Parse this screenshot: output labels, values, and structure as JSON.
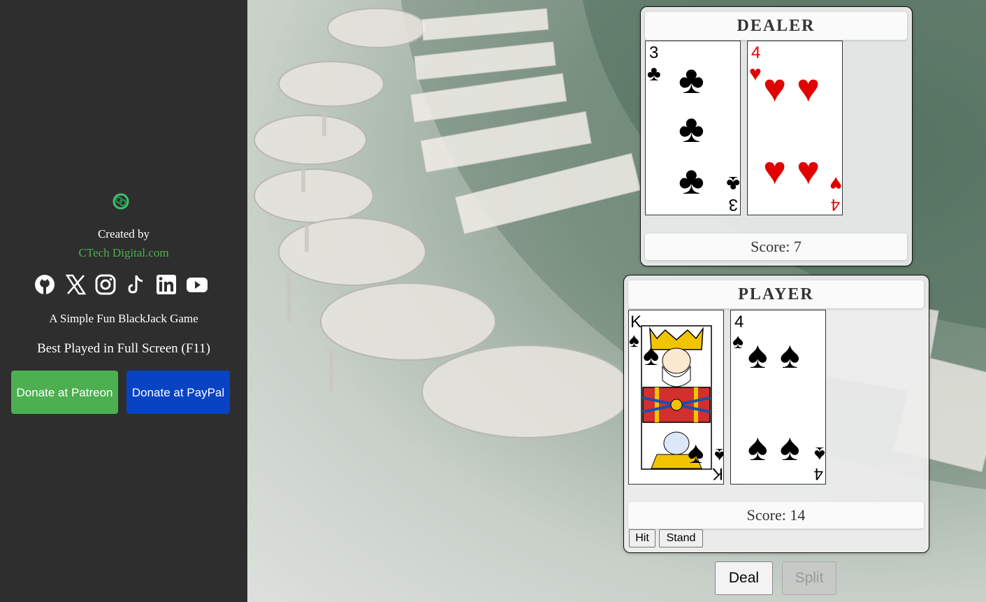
{
  "sidebar": {
    "logo_icon": "ctech-logo-icon",
    "created_by": "Created by",
    "site_link": "CTech Digital.com",
    "social_icons": [
      "github-icon",
      "x-icon",
      "instagram-icon",
      "tiktok-icon",
      "linkedin-icon",
      "youtube-icon"
    ],
    "tagline": "A Simple Fun BlackJack Game",
    "fullscreen_note": "Best Played in Full Screen (F11)",
    "donate_patreon": "Donate at Patreon",
    "donate_paypal": "Donate at PayPal"
  },
  "dealer": {
    "title": "DEALER",
    "cards": [
      {
        "rank": "3",
        "suit": "clubs",
        "symbol": "♣",
        "color": "#000000"
      },
      {
        "rank": "4",
        "suit": "hearts",
        "symbol": "♥",
        "color": "#e00000"
      }
    ],
    "score": "Score: 7"
  },
  "player": {
    "title": "PLAYER",
    "cards": [
      {
        "rank": "K",
        "suit": "spades",
        "symbol": "♠",
        "color": "#000000"
      },
      {
        "rank": "4",
        "suit": "spades",
        "symbol": "♠",
        "color": "#000000"
      }
    ],
    "score": "Score: 14",
    "hit_label": "Hit",
    "stand_label": "Stand"
  },
  "controls": {
    "deal_label": "Deal",
    "split_label": "Split"
  },
  "colors": {
    "sidebar_bg": "#2e2e2e",
    "link": "#4CAF50",
    "patreon": "#4CAF50",
    "paypal": "#0843C4"
  }
}
